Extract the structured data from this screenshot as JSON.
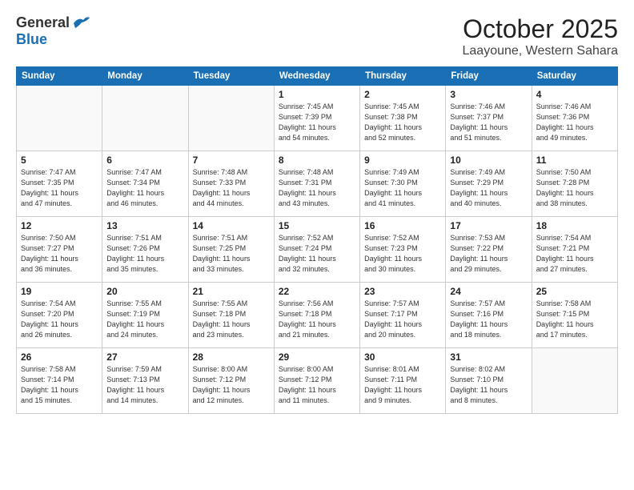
{
  "header": {
    "logo_general": "General",
    "logo_blue": "Blue",
    "month": "October 2025",
    "location": "Laayoune, Western Sahara"
  },
  "weekdays": [
    "Sunday",
    "Monday",
    "Tuesday",
    "Wednesday",
    "Thursday",
    "Friday",
    "Saturday"
  ],
  "weeks": [
    [
      {
        "day": "",
        "info": ""
      },
      {
        "day": "",
        "info": ""
      },
      {
        "day": "",
        "info": ""
      },
      {
        "day": "1",
        "info": "Sunrise: 7:45 AM\nSunset: 7:39 PM\nDaylight: 11 hours\nand 54 minutes."
      },
      {
        "day": "2",
        "info": "Sunrise: 7:45 AM\nSunset: 7:38 PM\nDaylight: 11 hours\nand 52 minutes."
      },
      {
        "day": "3",
        "info": "Sunrise: 7:46 AM\nSunset: 7:37 PM\nDaylight: 11 hours\nand 51 minutes."
      },
      {
        "day": "4",
        "info": "Sunrise: 7:46 AM\nSunset: 7:36 PM\nDaylight: 11 hours\nand 49 minutes."
      }
    ],
    [
      {
        "day": "5",
        "info": "Sunrise: 7:47 AM\nSunset: 7:35 PM\nDaylight: 11 hours\nand 47 minutes."
      },
      {
        "day": "6",
        "info": "Sunrise: 7:47 AM\nSunset: 7:34 PM\nDaylight: 11 hours\nand 46 minutes."
      },
      {
        "day": "7",
        "info": "Sunrise: 7:48 AM\nSunset: 7:33 PM\nDaylight: 11 hours\nand 44 minutes."
      },
      {
        "day": "8",
        "info": "Sunrise: 7:48 AM\nSunset: 7:31 PM\nDaylight: 11 hours\nand 43 minutes."
      },
      {
        "day": "9",
        "info": "Sunrise: 7:49 AM\nSunset: 7:30 PM\nDaylight: 11 hours\nand 41 minutes."
      },
      {
        "day": "10",
        "info": "Sunrise: 7:49 AM\nSunset: 7:29 PM\nDaylight: 11 hours\nand 40 minutes."
      },
      {
        "day": "11",
        "info": "Sunrise: 7:50 AM\nSunset: 7:28 PM\nDaylight: 11 hours\nand 38 minutes."
      }
    ],
    [
      {
        "day": "12",
        "info": "Sunrise: 7:50 AM\nSunset: 7:27 PM\nDaylight: 11 hours\nand 36 minutes."
      },
      {
        "day": "13",
        "info": "Sunrise: 7:51 AM\nSunset: 7:26 PM\nDaylight: 11 hours\nand 35 minutes."
      },
      {
        "day": "14",
        "info": "Sunrise: 7:51 AM\nSunset: 7:25 PM\nDaylight: 11 hours\nand 33 minutes."
      },
      {
        "day": "15",
        "info": "Sunrise: 7:52 AM\nSunset: 7:24 PM\nDaylight: 11 hours\nand 32 minutes."
      },
      {
        "day": "16",
        "info": "Sunrise: 7:52 AM\nSunset: 7:23 PM\nDaylight: 11 hours\nand 30 minutes."
      },
      {
        "day": "17",
        "info": "Sunrise: 7:53 AM\nSunset: 7:22 PM\nDaylight: 11 hours\nand 29 minutes."
      },
      {
        "day": "18",
        "info": "Sunrise: 7:54 AM\nSunset: 7:21 PM\nDaylight: 11 hours\nand 27 minutes."
      }
    ],
    [
      {
        "day": "19",
        "info": "Sunrise: 7:54 AM\nSunset: 7:20 PM\nDaylight: 11 hours\nand 26 minutes."
      },
      {
        "day": "20",
        "info": "Sunrise: 7:55 AM\nSunset: 7:19 PM\nDaylight: 11 hours\nand 24 minutes."
      },
      {
        "day": "21",
        "info": "Sunrise: 7:55 AM\nSunset: 7:18 PM\nDaylight: 11 hours\nand 23 minutes."
      },
      {
        "day": "22",
        "info": "Sunrise: 7:56 AM\nSunset: 7:18 PM\nDaylight: 11 hours\nand 21 minutes."
      },
      {
        "day": "23",
        "info": "Sunrise: 7:57 AM\nSunset: 7:17 PM\nDaylight: 11 hours\nand 20 minutes."
      },
      {
        "day": "24",
        "info": "Sunrise: 7:57 AM\nSunset: 7:16 PM\nDaylight: 11 hours\nand 18 minutes."
      },
      {
        "day": "25",
        "info": "Sunrise: 7:58 AM\nSunset: 7:15 PM\nDaylight: 11 hours\nand 17 minutes."
      }
    ],
    [
      {
        "day": "26",
        "info": "Sunrise: 7:58 AM\nSunset: 7:14 PM\nDaylight: 11 hours\nand 15 minutes."
      },
      {
        "day": "27",
        "info": "Sunrise: 7:59 AM\nSunset: 7:13 PM\nDaylight: 11 hours\nand 14 minutes."
      },
      {
        "day": "28",
        "info": "Sunrise: 8:00 AM\nSunset: 7:12 PM\nDaylight: 11 hours\nand 12 minutes."
      },
      {
        "day": "29",
        "info": "Sunrise: 8:00 AM\nSunset: 7:12 PM\nDaylight: 11 hours\nand 11 minutes."
      },
      {
        "day": "30",
        "info": "Sunrise: 8:01 AM\nSunset: 7:11 PM\nDaylight: 11 hours\nand 9 minutes."
      },
      {
        "day": "31",
        "info": "Sunrise: 8:02 AM\nSunset: 7:10 PM\nDaylight: 11 hours\nand 8 minutes."
      },
      {
        "day": "",
        "info": ""
      }
    ]
  ]
}
